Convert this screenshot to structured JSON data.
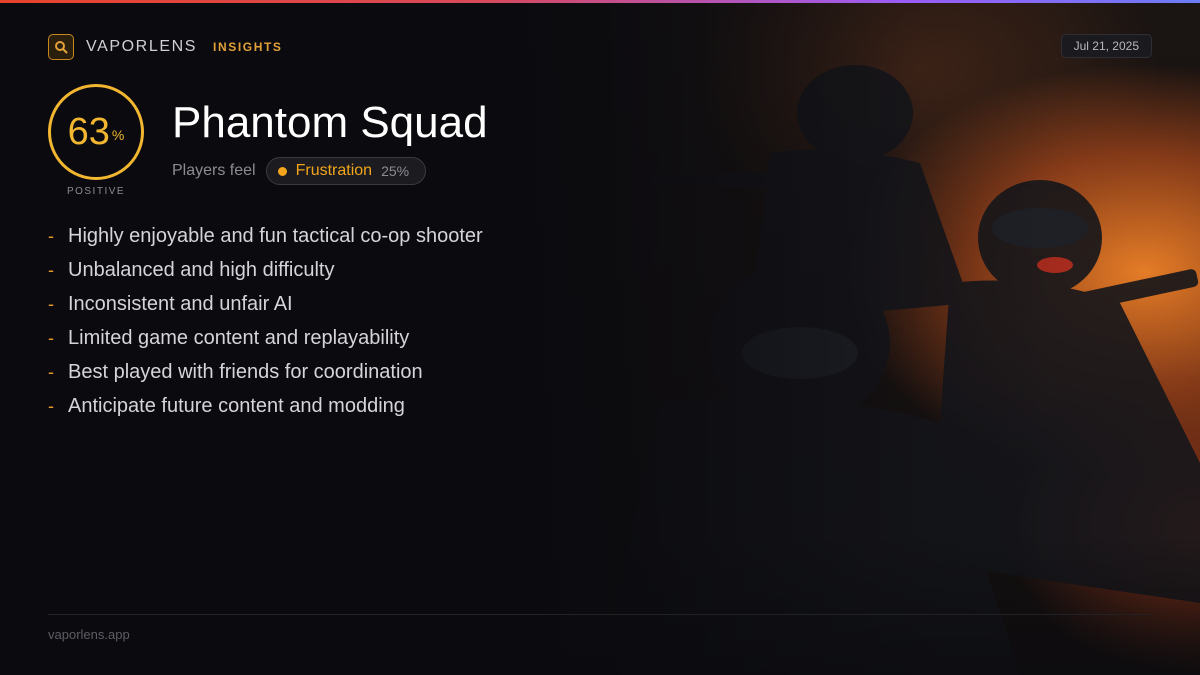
{
  "header": {
    "brand": "VAPORLENS",
    "section": "INSIGHTS",
    "date": "Jul 21, 2025",
    "logo_icon": "search-icon"
  },
  "score": {
    "value": "63",
    "unit": "%",
    "label": "POSITIVE",
    "color": "#f2b631"
  },
  "game": {
    "title": "Phantom Squad"
  },
  "sentiment": {
    "prefix": "Players feel",
    "emotion": "Frustration",
    "percent": "25%",
    "color": "#f2a51a"
  },
  "points": [
    "Highly enjoyable and fun tactical co-op shooter",
    "Unbalanced and high difficulty",
    "Inconsistent and unfair AI",
    "Limited game content and replayability",
    "Best played with friends for coordination",
    "Anticipate future content and modding"
  ],
  "bullet_glyph": "-",
  "footer": {
    "site": "vaporlens.app"
  },
  "colors": {
    "accent": "#e3a13a",
    "background": "#0b0b0f"
  }
}
